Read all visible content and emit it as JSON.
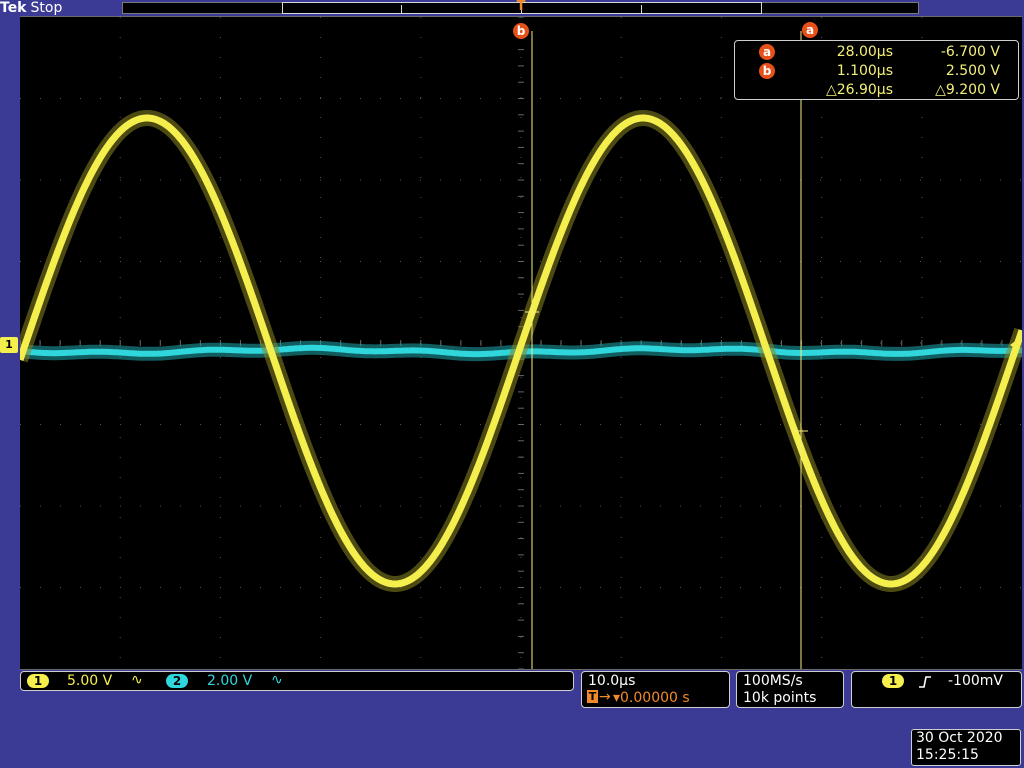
{
  "header": {
    "brand": "Tek",
    "acq_state": "Stop"
  },
  "trigger_position_marker": "T",
  "cursor_labels": {
    "a": "a",
    "b": "b"
  },
  "cursor_readout": {
    "a": {
      "label": "a",
      "time": "28.00µs",
      "voltage": "-6.700 V"
    },
    "b": {
      "label": "b",
      "time": "1.100µs",
      "voltage": "2.500 V"
    },
    "delta": {
      "time": "△26.90µs",
      "voltage": "△9.200 V"
    }
  },
  "channels": [
    {
      "id": "1",
      "scale": "5.00 V",
      "coupling_icon": "∿",
      "color": "#f5ef4d"
    },
    {
      "id": "2",
      "scale": "2.00 V",
      "coupling_icon": "∿",
      "color": "#2fd6dc"
    }
  ],
  "left_marker": "1",
  "horizontal": {
    "scale": "10.0µs",
    "trigger_label": "T",
    "delay": "▾0.00000 s",
    "delay_prefix": "→"
  },
  "acquisition": {
    "sample_rate": "100MS/s",
    "record_length": "10k points"
  },
  "trigger": {
    "source": "1",
    "slope_icon": "rising-edge",
    "level": "-100mV"
  },
  "datetime": {
    "date": "30 Oct  2020",
    "time": "15:25:15"
  },
  "colors": {
    "ch1": "#f5ef4d",
    "ch2": "#2fd6dc",
    "cursor": "#f3f07a",
    "cursor_badge": "#e8501a",
    "frame": "#3b3b96"
  }
}
